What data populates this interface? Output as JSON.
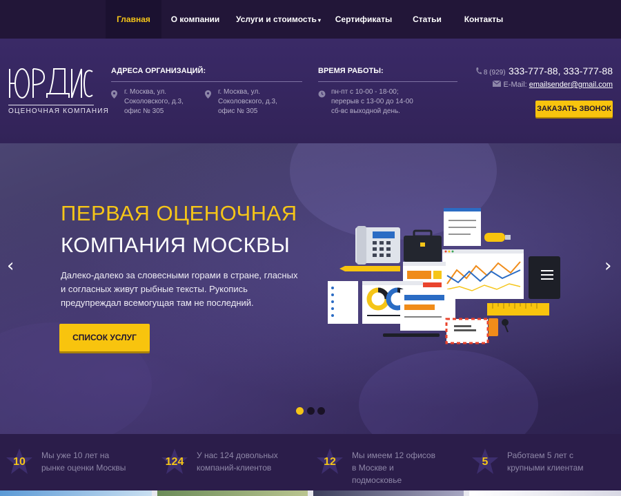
{
  "nav": {
    "items": [
      {
        "label": "Главная",
        "active": true
      },
      {
        "label": "О компании",
        "active": false
      },
      {
        "label": "Услуги и стоимость",
        "active": false,
        "dropdown": true
      },
      {
        "label": "Сертификаты",
        "active": false
      },
      {
        "label": "Статьи",
        "active": false
      },
      {
        "label": "Контакты",
        "active": false
      }
    ],
    "caret": "▾"
  },
  "header": {
    "logo_text": "ЮРДИС",
    "logo_sub": "ОЦЕНОЧНАЯ КОМПАНИЯ",
    "address_title": "АДРЕСА ОРГАНИЗАЦИЙ:",
    "address_1": "г. Москва, ул. Соколовского, д.3, офис № 305",
    "address_2": "г. Москва, ул. Соколовского, д.3, офис № 305",
    "hours_title": "ВРЕМЯ РАБОТЫ:",
    "hours": "пн-пт с 10-00 - 18-00; перерыв с 13-00 до 14-00 сб-вс выходной день.",
    "phone_prefix": "8 (929)",
    "phone_numbers": "333-777-88, 333-777-88",
    "email_label": "E-Mail:",
    "email": "emailsender@gmail.com",
    "call_button": "ЗАКАЗАТЬ ЗВОНОК"
  },
  "hero": {
    "title_line_1": "ПЕРВАЯ ОЦЕНОЧНАЯ",
    "title_line_2": "КОМПАНИЯ МОСКВЫ",
    "text": "Далеко-далеко за словесными горами в стране, гласных и согласных живут рыбные тексты. Рукопись предупреждал всемогущая там не последний.",
    "button": "СПИСОК УСЛУГ",
    "prev_arrow": "‹",
    "next_arrow": "›",
    "slides": 3,
    "active_slide": 1
  },
  "stats": [
    {
      "number": "10",
      "text": "Мы уже 10 лет на рынке оценки Москвы"
    },
    {
      "number": "124",
      "text": "У нас 124 довольных компаний-клиентов"
    },
    {
      "number": "12",
      "text": "Мы имеем 12 офисов в Москве и подмосковье"
    },
    {
      "number": "5",
      "text": "Работаем 5 лет с крупными клиентам"
    }
  ],
  "colors": {
    "accent": "#f5c518",
    "nav_bg": "#221638",
    "header_bg": "#3a2a67",
    "stats_bg": "#2b1d4a"
  },
  "icons": {
    "pin": "location-pin-icon",
    "clock": "clock-icon",
    "phone": "phone-icon",
    "mail": "mail-icon",
    "star": "star-icon",
    "menu": "hamburger-menu-icon"
  }
}
